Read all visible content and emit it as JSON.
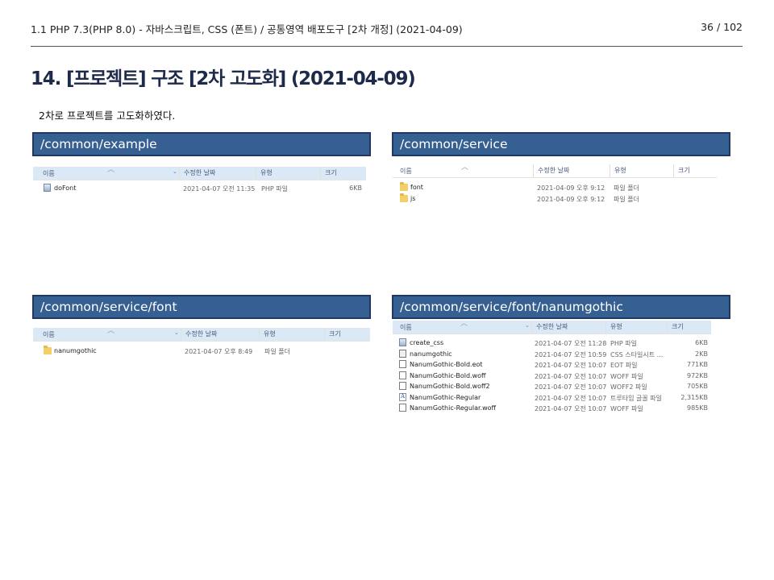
{
  "header": {
    "title": "1.1 PHP 7.3(PHP 8.0) - 자바스크립트, CSS (폰트) / 공통영역 배포도구 [2차 개정] (2021-04-09)",
    "page": "36 / 102"
  },
  "section": {
    "title": "14. [프로젝트] 구조 [2차 고도화] (2021-04-09)",
    "intro": "2차로 프로젝트를 고도화하였다."
  },
  "colors": {
    "panel_bg": "#376092",
    "panel_border": "#1f3864",
    "title_text": "#1e2a4a",
    "folder": "#f3cf65"
  },
  "panels": [
    {
      "title": "/common/example",
      "columns": {
        "name": "이름",
        "date": "수정한 날짜",
        "type": "유형",
        "size": "크기"
      },
      "files": [
        {
          "icon": "php-file-icon",
          "name": "doFont",
          "date": "2021-04-07 오전 11:35",
          "type": "PHP 파일",
          "size": "6KB"
        }
      ]
    },
    {
      "title": "/common/service",
      "columns": {
        "name": "이름",
        "date": "수정한 날짜",
        "type": "유형",
        "size": "크기"
      },
      "files": [
        {
          "icon": "folder-icon",
          "name": "font",
          "date": "2021-04-09 오후 9:12",
          "type": "파일 폴더",
          "size": ""
        },
        {
          "icon": "folder-icon",
          "name": "js",
          "date": "2021-04-09 오후 9:12",
          "type": "파일 폴더",
          "size": ""
        }
      ]
    },
    {
      "title": "/common/service/font",
      "columns": {
        "name": "이름",
        "date": "수정한 날짜",
        "type": "유형",
        "size": "크기"
      },
      "files": [
        {
          "icon": "folder-icon",
          "name": "nanumgothic",
          "date": "2021-04-07 오후 8:49",
          "type": "파일 폴더",
          "size": ""
        }
      ]
    },
    {
      "title": "/common/service/font/nanumgothic",
      "columns": {
        "name": "이름",
        "date": "수정한 날짜",
        "type": "유형",
        "size": "크기"
      },
      "files": [
        {
          "icon": "php-file-icon",
          "name": "create_css",
          "date": "2021-04-07 오전 11:28",
          "type": "PHP 파일",
          "size": "6KB"
        },
        {
          "icon": "css-file-icon",
          "name": "nanumgothic",
          "date": "2021-04-07 오전 10:59",
          "type": "CSS 스타일시트 ...",
          "size": "2KB"
        },
        {
          "icon": "file-icon",
          "name": "NanumGothic-Bold.eot",
          "date": "2021-04-07 오전 10:07",
          "type": "EOT 파일",
          "size": "771KB"
        },
        {
          "icon": "file-icon",
          "name": "NanumGothic-Bold.woff",
          "date": "2021-04-07 오전 10:07",
          "type": "WOFF 파일",
          "size": "972KB"
        },
        {
          "icon": "file-icon",
          "name": "NanumGothic-Bold.woff2",
          "date": "2021-04-07 오전 10:07",
          "type": "WOFF2 파일",
          "size": "705KB"
        },
        {
          "icon": "font-file-icon",
          "name": "NanumGothic-Regular",
          "date": "2021-04-07 오전 10:07",
          "type": "트루타입 글꼴 파일",
          "size": "2,315KB"
        },
        {
          "icon": "file-icon",
          "name": "NanumGothic-Regular.woff",
          "date": "2021-04-07 오전 10:07",
          "type": "WOFF 파일",
          "size": "985KB"
        }
      ]
    }
  ]
}
